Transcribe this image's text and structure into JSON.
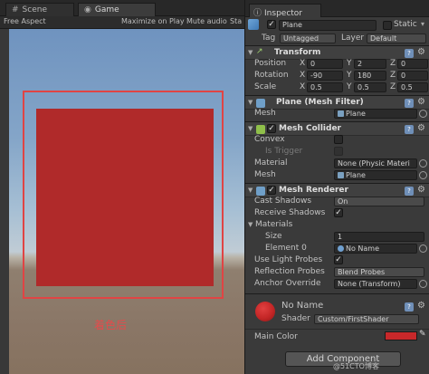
{
  "game_panel": {
    "tabs": [
      {
        "label": "Scene",
        "icon": "scene-icon"
      },
      {
        "label": "Game",
        "icon": "game-icon"
      }
    ],
    "toolbar": {
      "aspect": "Free Aspect",
      "maximize": "Maximize on Play",
      "mute": "Mute audio",
      "stats": "Sta"
    },
    "caption": "着色后",
    "colors": {
      "quad": "#b02a2a",
      "outline": "#e04444",
      "sky": "#7b9cc4",
      "ground": "#86725f"
    }
  },
  "inspector": {
    "tab_label": "Inspector",
    "object": {
      "name": "Plane",
      "static_label": "Static",
      "tag_label": "Tag",
      "tag_value": "Untagged",
      "layer_label": "Layer",
      "layer_value": "Default"
    },
    "transform": {
      "title": "Transform",
      "position": {
        "label": "Position",
        "x": "0",
        "y": "2",
        "z": "0"
      },
      "rotation": {
        "label": "Rotation",
        "x": "-90",
        "y": "180",
        "z": "0"
      },
      "scale": {
        "label": "Scale",
        "x": "0.5",
        "y": "0.5",
        "z": "0.5"
      }
    },
    "mesh_filter": {
      "title": "Plane (Mesh Filter)",
      "mesh_label": "Mesh",
      "mesh_value": "Plane"
    },
    "mesh_collider": {
      "title": "Mesh Collider",
      "convex": "Convex",
      "is_trigger": "Is Trigger",
      "material_label": "Material",
      "material_value": "None (Physic Materi",
      "mesh_label": "Mesh",
      "mesh_value": "Plane"
    },
    "mesh_renderer": {
      "title": "Mesh Renderer",
      "cast_shadows": {
        "label": "Cast Shadows",
        "value": "On"
      },
      "receive_shadows": "Receive Shadows",
      "materials": "Materials",
      "size": {
        "label": "Size",
        "value": "1"
      },
      "element0": {
        "label": "Element 0",
        "value": "No Name"
      },
      "light_probes": "Use Light Probes",
      "reflection": {
        "label": "Reflection Probes",
        "value": "Blend Probes"
      },
      "anchor": {
        "label": "Anchor Override",
        "value": "None (Transform)"
      }
    },
    "material": {
      "name": "No Name",
      "shader_label": "Shader",
      "shader_value": "Custom/FirstShader",
      "main_color_label": "Main Color",
      "main_color": "#c8282a",
      "sphere_color": "#c42626"
    },
    "add_component": "Add Component",
    "watermark": "@51CTO博客"
  }
}
